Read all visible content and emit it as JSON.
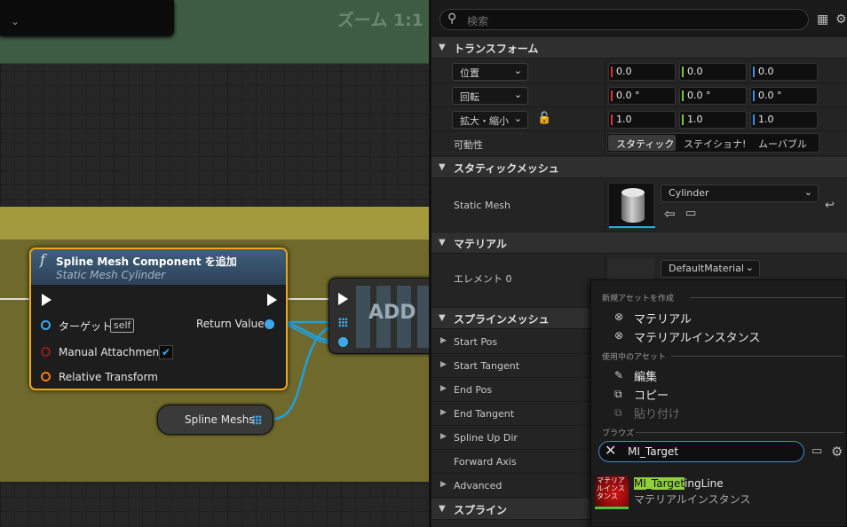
{
  "graph": {
    "zoom_label": "ズーム 1:1",
    "node": {
      "function_glyph": "f",
      "title": "Spline Mesh Component を追加",
      "subtitle": "Static Mesh Cylinder",
      "pins": {
        "target_label": "ターゲット",
        "target_default": "self",
        "return_label": "Return Value",
        "manual_attachment_label": "Manual Attachment",
        "manual_attachment_check": "✔",
        "relative_transform_label": "Relative Transform"
      }
    },
    "add_node": {
      "label": "ADD"
    },
    "getter": {
      "label": "Spline Meshs"
    }
  },
  "details": {
    "search_placeholder": "検索",
    "sections": {
      "transform": "トランスフォーム",
      "static_mesh": "スタティックメッシュ",
      "material": "マテリアル",
      "spline_mesh": "スプラインメッシュ",
      "spline": "スプライン"
    },
    "transform": {
      "location_label": "位置",
      "location": [
        "0.0",
        "0.0",
        "0.0"
      ],
      "rotation_label": "回転",
      "rotation": [
        "0.0 °",
        "0.0 °",
        "0.0 °"
      ],
      "scale_label": "拡大・縮小",
      "scale": [
        "1.0",
        "1.0",
        "1.0"
      ],
      "mobility_label": "可動性",
      "mobility_options": [
        "スタティック",
        "ステイショナ!",
        "ムーバブル"
      ]
    },
    "static_mesh": {
      "label": "Static Mesh",
      "value": "Cylinder"
    },
    "material": {
      "label": "エレメント 0",
      "value": "DefaultMaterial"
    },
    "spline_mesh_rows": [
      "Start Pos",
      "Start Tangent",
      "End Pos",
      "End Tangent",
      "Spline Up Dir",
      "Forward Axis",
      "Advanced"
    ]
  },
  "menu": {
    "create_header": "新規アセットを作成",
    "create_items": [
      "マテリアル",
      "マテリアルインスタンス"
    ],
    "current_header": "使用中のアセット",
    "edit": "編集",
    "copy": "コピー",
    "paste": "貼り付け",
    "browse_header": "ブラウズ",
    "search_value": "MI_Target",
    "result_thumb_text": "マテリア\nルインス\nタンス",
    "result_name_hl": "MI_Target",
    "result_name_rest": "ingLine",
    "result_type": "マテリアルインスタンス"
  },
  "colors": {
    "x_axis": "#e03030",
    "y_axis": "#7ac43c",
    "z_axis": "#3a8ee6",
    "selected_border": "#f0a71a"
  }
}
